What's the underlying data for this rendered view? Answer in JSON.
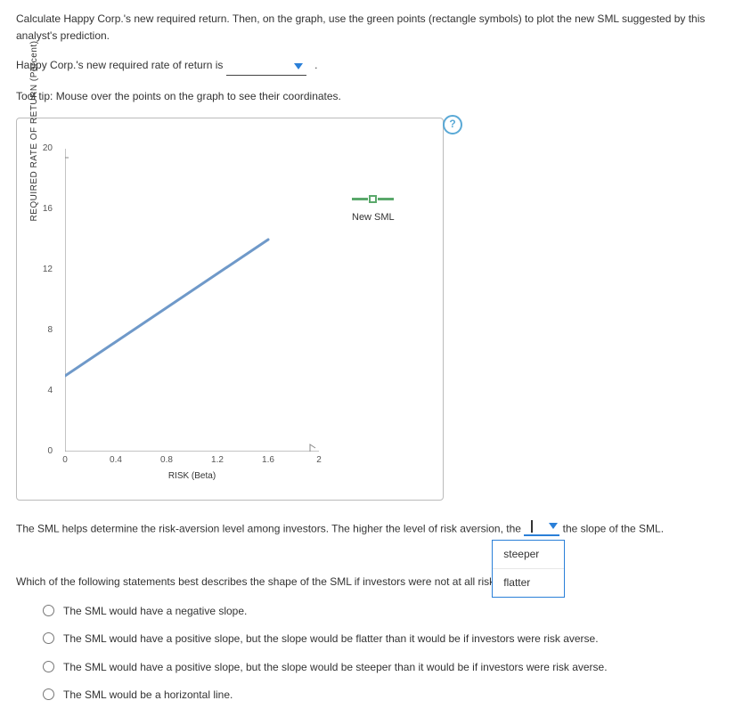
{
  "intro_text": "Calculate Happy Corp.'s new required return. Then, on the graph, use the green points (rectangle symbols) to plot the new SML suggested by this analyst's prediction.",
  "rr_sentence_pre": "Happy Corp.'s new required rate of return is ",
  "tooltip_text": "Tool tip: Mouse over the points on the graph to see their coordinates.",
  "help_icon": "?",
  "legend": {
    "label": "New SML"
  },
  "risk_aversion_sentence": {
    "pre": "The SML helps determine the risk-aversion level among investors. The higher the level of risk aversion, the ",
    "post": " the slope of the SML."
  },
  "dropdown_options": [
    "steeper",
    "flatter"
  ],
  "mc_prompt": "Which of the following statements best describes the shape of the SML if investors were not at all risk averse?",
  "mc_options": [
    "The SML would have a negative slope.",
    "The SML would have a positive slope, but the slope would be flatter than it would be if investors were risk averse.",
    "The SML would have a positive slope, but the slope would be steeper than it would be if investors were risk averse.",
    "The SML would be a horizontal line."
  ],
  "chart_data": {
    "type": "line",
    "title": "",
    "xlabel": "RISK (Beta)",
    "ylabel": "REQUIRED RATE OF RETURN (Percent)",
    "xlim": [
      0,
      2.0
    ],
    "ylim": [
      0,
      20
    ],
    "x_ticks": [
      0,
      0.4,
      0.8,
      1.2,
      1.6,
      2.0
    ],
    "y_ticks": [
      0,
      4,
      8,
      12,
      16,
      20
    ],
    "series": [
      {
        "name": "SML",
        "color": "#6f99c9",
        "points": [
          [
            0,
            5
          ],
          [
            1.6,
            14
          ]
        ]
      }
    ]
  }
}
